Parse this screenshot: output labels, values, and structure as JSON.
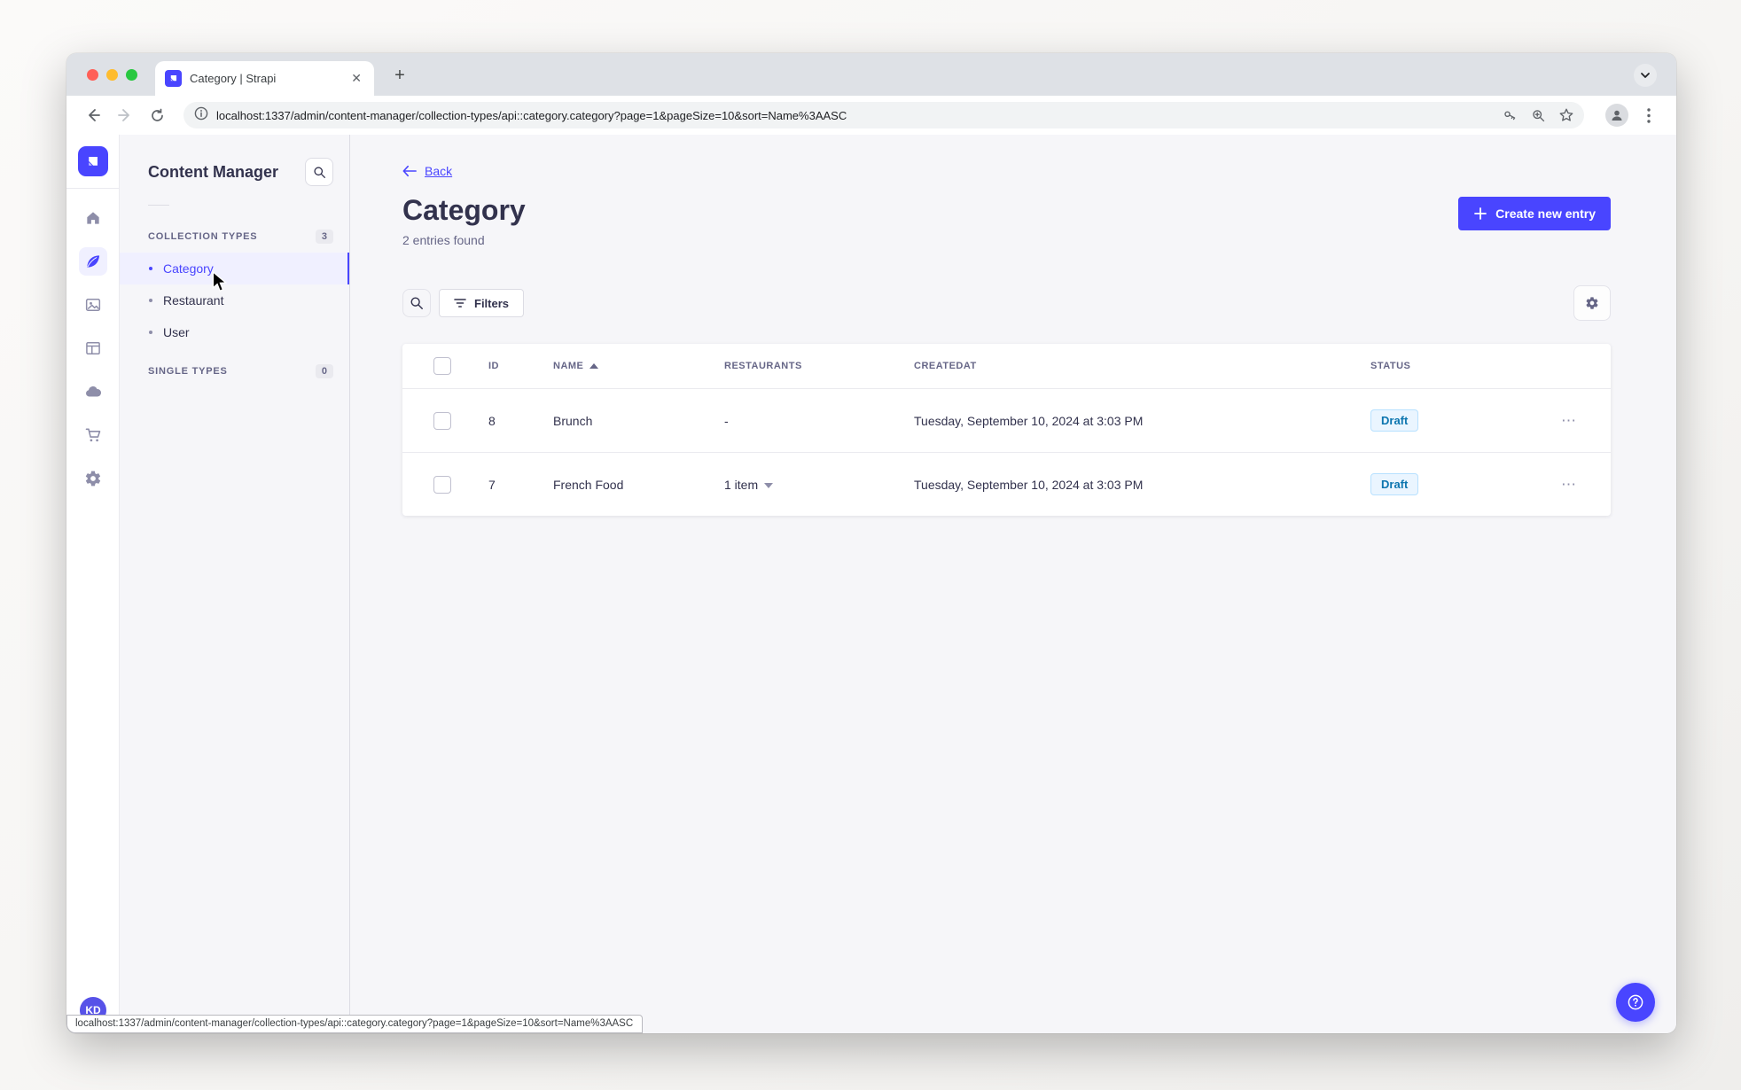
{
  "browser": {
    "tab_title": "Category | Strapi",
    "url": "localhost:1337/admin/content-manager/collection-types/api::category.category?page=1&pageSize=10&sort=Name%3AASC",
    "status_url": "localhost:1337/admin/content-manager/collection-types/api::category.category?page=1&pageSize=10&sort=Name%3AASC"
  },
  "rail": {
    "avatar_initials": "KD",
    "icons": [
      "strapi-logo",
      "home",
      "content-manager",
      "media-library",
      "content-type-builder",
      "deploy-cloud",
      "marketplace",
      "settings"
    ]
  },
  "subnav": {
    "title": "Content Manager",
    "collection_types": {
      "label": "COLLECTION TYPES",
      "count": "3",
      "items": [
        {
          "label": "Category"
        },
        {
          "label": "Restaurant"
        },
        {
          "label": "User"
        }
      ]
    },
    "single_types": {
      "label": "SINGLE TYPES",
      "count": "0"
    }
  },
  "main": {
    "back": "Back",
    "title": "Category",
    "subtitle": "2 entries found",
    "create_button": "Create new entry",
    "filters_button": "Filters",
    "table": {
      "columns": [
        "ID",
        "NAME",
        "RESTAURANTS",
        "CREATEDAT",
        "STATUS"
      ],
      "rows": [
        {
          "id": "8",
          "name": "Brunch",
          "restaurants": "-",
          "created_at": "Tuesday, September 10, 2024 at 3:03 PM",
          "status": "Draft"
        },
        {
          "id": "7",
          "name": "French Food",
          "restaurants": "1 item",
          "created_at": "Tuesday, September 10, 2024 at 3:03 PM",
          "status": "Draft"
        }
      ]
    }
  },
  "colors": {
    "accent": "#4945ff",
    "accent_bg": "#f0f0ff",
    "draft_text": "#0c75af",
    "draft_bg": "#eaf5ff",
    "draft_border": "#b8e1ff"
  }
}
